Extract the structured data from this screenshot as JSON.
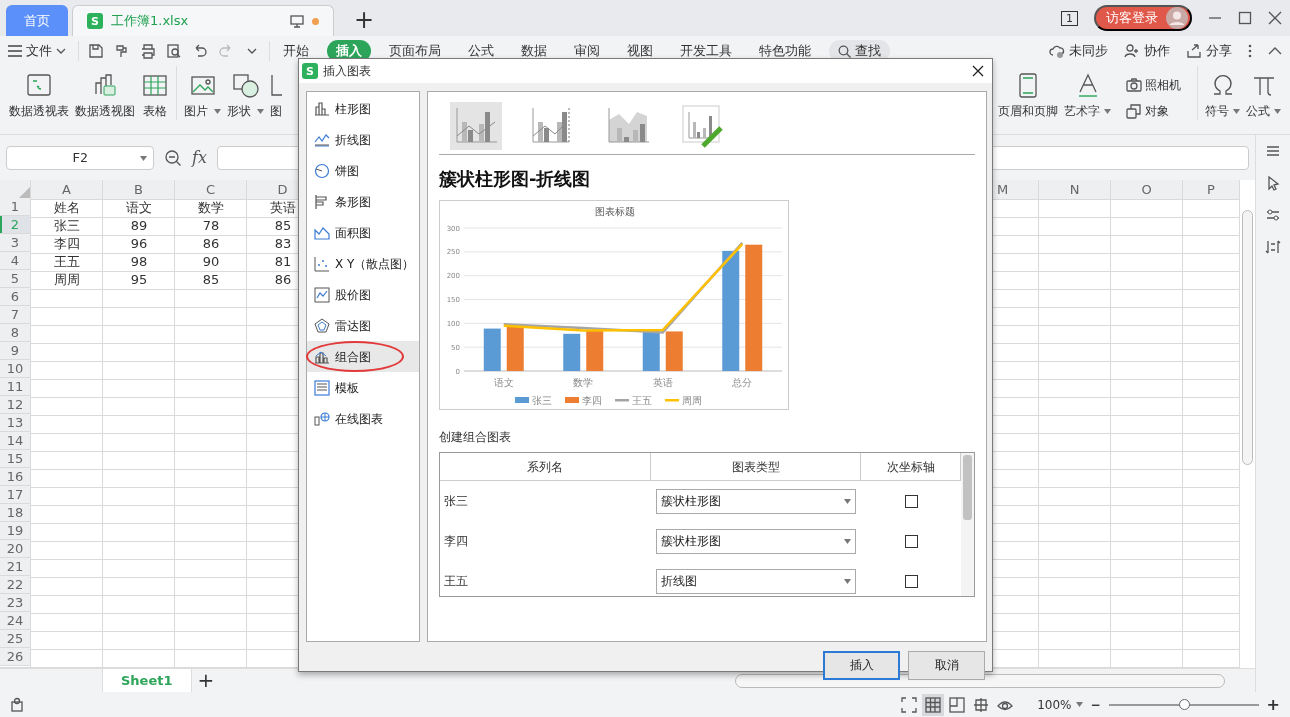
{
  "titlebar": {
    "tabs": [
      {
        "label": "首页",
        "kind": "home",
        "selected": false
      },
      {
        "label": "工作簿1.xlsx",
        "kind": "doc",
        "logo": "S",
        "selected": true,
        "unsaved": true
      }
    ],
    "new_tab": "+",
    "window_count": "1",
    "login": "访客登录"
  },
  "menubar": {
    "file": "文件",
    "tabs": [
      {
        "label": "开始",
        "selected": false
      },
      {
        "label": "插入",
        "selected": true
      },
      {
        "label": "页面布局",
        "selected": false
      },
      {
        "label": "公式",
        "selected": false
      },
      {
        "label": "数据",
        "selected": false
      },
      {
        "label": "审阅",
        "selected": false
      },
      {
        "label": "视图",
        "selected": false
      },
      {
        "label": "开发工具",
        "selected": false
      },
      {
        "label": "特色功能",
        "selected": false
      }
    ],
    "search": "查找",
    "actions": [
      "未同步",
      "协作",
      "分享"
    ]
  },
  "ribbon": {
    "left_tools": [
      {
        "label": "数据透视表",
        "dropdown": false
      },
      {
        "label": "数据透视图",
        "dropdown": false
      },
      {
        "label": "表格",
        "dropdown": false
      },
      {
        "label": "图片",
        "dropdown": true
      },
      {
        "label": "形状",
        "dropdown": true
      },
      {
        "label": "图",
        "dropdown": false
      }
    ],
    "right_tools": [
      {
        "kind": "large",
        "label": "页眉和页脚",
        "dropdown": false
      },
      {
        "kind": "large",
        "label": "艺术字",
        "dropdown": true
      },
      {
        "kind": "stack",
        "items": [
          {
            "label": "照相机"
          },
          {
            "label": "对象"
          }
        ]
      },
      {
        "kind": "large",
        "label": "符号",
        "dropdown": true
      },
      {
        "kind": "large",
        "label": "公式",
        "dropdown": true
      }
    ]
  },
  "formula_bar": {
    "name_box": "F2",
    "fx": "fx"
  },
  "sheet": {
    "columns_left": [
      "A",
      "B",
      "C",
      "D"
    ],
    "columns_right": [
      "M",
      "N",
      "O",
      "P"
    ],
    "rows": [
      {
        "number": "1",
        "selected": false,
        "cells": [
          "姓名",
          "语文",
          "数学",
          "英语"
        ]
      },
      {
        "number": "2",
        "selected": true,
        "cells": [
          "张三",
          "89",
          "78",
          "85"
        ]
      },
      {
        "number": "3",
        "selected": false,
        "cells": [
          "李四",
          "96",
          "86",
          "83"
        ]
      },
      {
        "number": "4",
        "selected": false,
        "cells": [
          "王五",
          "98",
          "90",
          "81"
        ]
      },
      {
        "number": "5",
        "selected": false,
        "cells": [
          "周周",
          "95",
          "85",
          "86"
        ]
      },
      {
        "number": "6",
        "selected": false
      },
      {
        "number": "7",
        "selected": false
      },
      {
        "number": "8",
        "selected": false
      },
      {
        "number": "9",
        "selected": false
      },
      {
        "number": "10",
        "selected": false
      },
      {
        "number": "11",
        "selected": false
      },
      {
        "number": "12",
        "selected": false
      },
      {
        "number": "13",
        "selected": false
      },
      {
        "number": "14",
        "selected": false
      },
      {
        "number": "15",
        "selected": false
      },
      {
        "number": "16",
        "selected": false
      },
      {
        "number": "17",
        "selected": false
      },
      {
        "number": "18",
        "selected": false
      },
      {
        "number": "19",
        "selected": false
      },
      {
        "number": "20",
        "selected": false
      },
      {
        "number": "21",
        "selected": false
      },
      {
        "number": "22",
        "selected": false
      },
      {
        "number": "23",
        "selected": false
      },
      {
        "number": "24",
        "selected": false
      },
      {
        "number": "25",
        "selected": false
      },
      {
        "number": "26",
        "selected": false
      }
    ]
  },
  "sheet_tabs": [
    {
      "label": "Sheet1",
      "selected": true
    }
  ],
  "add_sheet": "+",
  "status_bar": {
    "zoom": "100%",
    "zoom_out": "−",
    "zoom_in": "+",
    "zoom_slider": {
      "level": 0.5
    }
  },
  "dialog": {
    "title": "插入图表",
    "logo": "S",
    "categories": [
      {
        "label": "柱形图",
        "selected": false,
        "highlighted": false
      },
      {
        "label": "折线图",
        "selected": false,
        "highlighted": false
      },
      {
        "label": "饼图",
        "selected": false,
        "highlighted": false
      },
      {
        "label": "条形图",
        "selected": false,
        "highlighted": false
      },
      {
        "label": "面积图",
        "selected": false,
        "highlighted": false
      },
      {
        "label": "X Y（散点图）",
        "selected": false,
        "highlighted": false
      },
      {
        "label": "股价图",
        "selected": false,
        "highlighted": false
      },
      {
        "label": "雷达图",
        "selected": false,
        "highlighted": false
      },
      {
        "label": "组合图",
        "selected": true,
        "highlighted": true
      },
      {
        "label": "模板",
        "selected": false,
        "highlighted": false
      },
      {
        "label": "在线图表",
        "selected": false,
        "highlighted": false
      }
    ],
    "subtypes": [
      {
        "selected": true
      },
      {
        "selected": false
      },
      {
        "selected": false
      },
      {
        "selected": false
      }
    ],
    "heading": "簇状柱形图-折线图",
    "preview": {
      "chart_data": {
        "type": "bar",
        "title": "图表标题",
        "categories": [
          "语文",
          "数学",
          "英语",
          "总分"
        ],
        "series": [
          {
            "name": "张三",
            "type": "bar",
            "color": "#5b9bd5",
            "values": [
              89,
              78,
              85,
              252
            ]
          },
          {
            "name": "李四",
            "type": "bar",
            "color": "#ed7d31",
            "values": [
              96,
              86,
              83,
              265
            ]
          },
          {
            "name": "王五",
            "type": "line",
            "color": "#a5a5a5",
            "values": [
              98,
              90,
              81,
              269
            ]
          },
          {
            "name": "周周",
            "type": "line",
            "color": "#ffc000",
            "values": [
              95,
              85,
              86,
              266
            ]
          }
        ],
        "grid": true,
        "legend": "bottom",
        "ylim": [
          0,
          300
        ],
        "yticks": [
          0,
          50,
          100,
          150,
          200,
          250,
          300
        ]
      }
    },
    "combo_label": "创建组合图表",
    "combo_table": {
      "columns": [
        "系列名",
        "图表类型",
        "次坐标轴"
      ],
      "rows": [
        {
          "name": "张三",
          "chart_type": "簇状柱形图",
          "secondary_axis": false
        },
        {
          "name": "李四",
          "chart_type": "簇状柱形图",
          "secondary_axis": false
        },
        {
          "name": "王五",
          "chart_type": "折线图",
          "secondary_axis": false
        }
      ]
    },
    "buttons": [
      {
        "label": "插入",
        "kind": "primary"
      },
      {
        "label": "取消",
        "kind": "secondary"
      }
    ]
  }
}
